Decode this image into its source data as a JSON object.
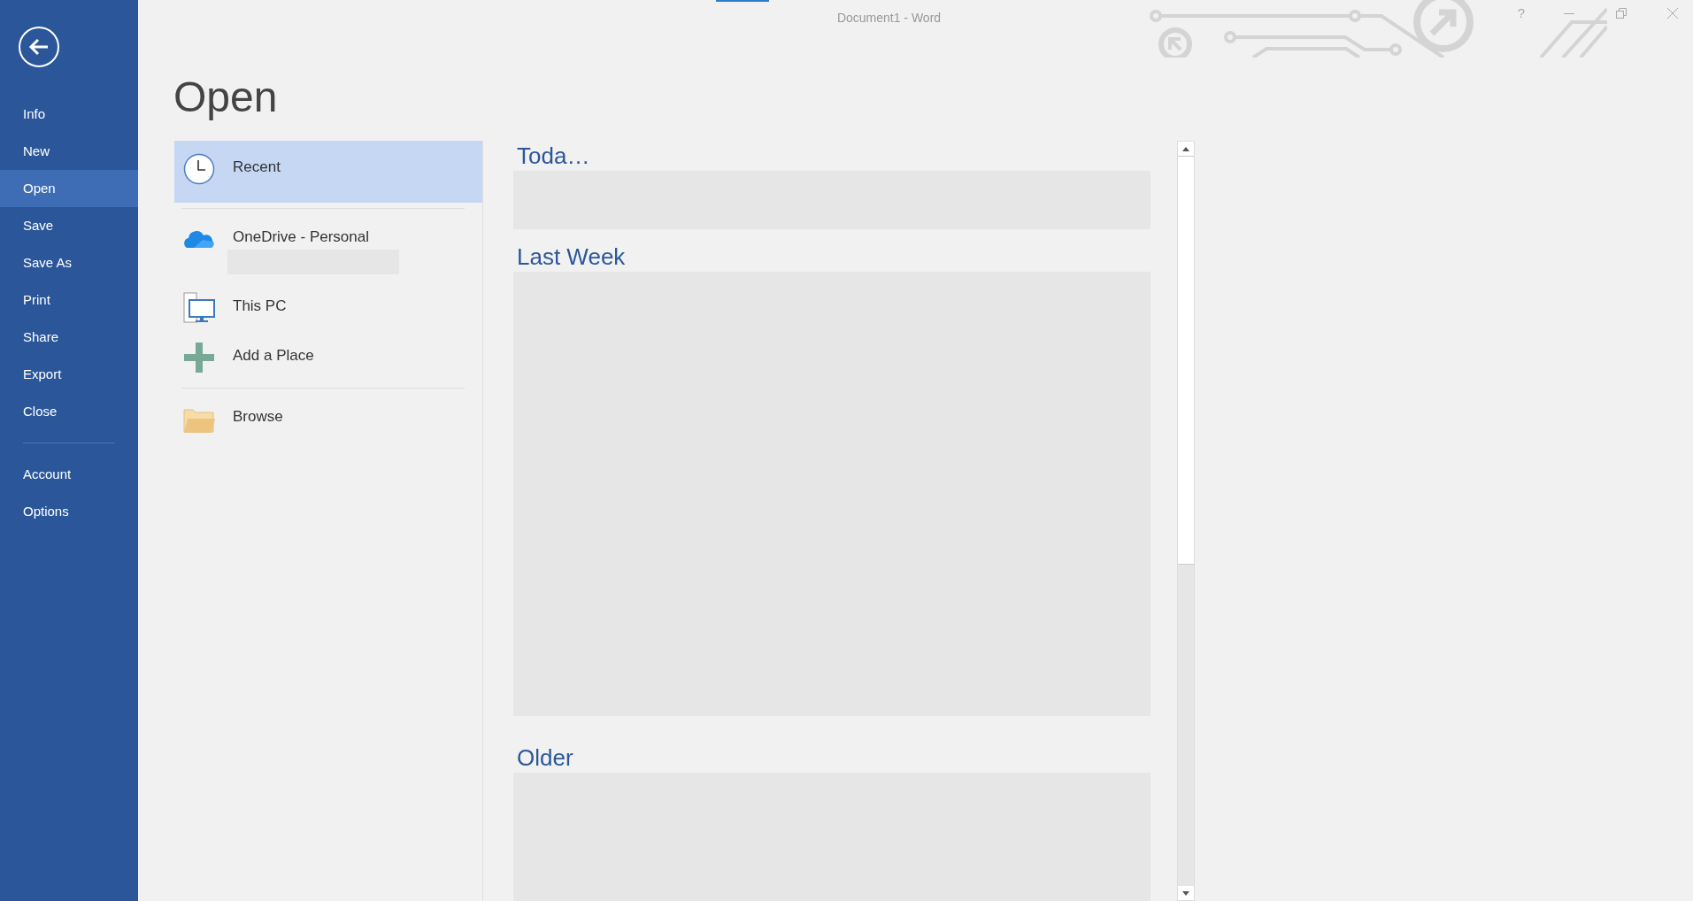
{
  "window": {
    "title": "Document1 - Word",
    "help": "?"
  },
  "sidebar": {
    "items": [
      {
        "label": "Info",
        "selected": false
      },
      {
        "label": "New",
        "selected": false
      },
      {
        "label": "Open",
        "selected": true
      },
      {
        "label": "Save",
        "selected": false
      },
      {
        "label": "Save As",
        "selected": false
      },
      {
        "label": "Print",
        "selected": false
      },
      {
        "label": "Share",
        "selected": false
      },
      {
        "label": "Export",
        "selected": false
      },
      {
        "label": "Close",
        "selected": false
      }
    ],
    "bottom_items": [
      {
        "label": "Account",
        "selected": false
      },
      {
        "label": "Options",
        "selected": false
      }
    ]
  },
  "page_title": "Open",
  "places": [
    {
      "label": "Recent",
      "kind": "clock",
      "selected": true
    },
    {
      "label": "OneDrive - Personal",
      "kind": "cloud",
      "selected": false
    },
    {
      "label": "This PC",
      "kind": "pc",
      "selected": false
    },
    {
      "label": "Add a Place",
      "kind": "plus",
      "selected": false
    },
    {
      "label": "Browse",
      "kind": "folder",
      "selected": false
    }
  ],
  "recent_groups": [
    {
      "heading": "Toda…"
    },
    {
      "heading": "Last Week"
    },
    {
      "heading": "Older"
    }
  ]
}
